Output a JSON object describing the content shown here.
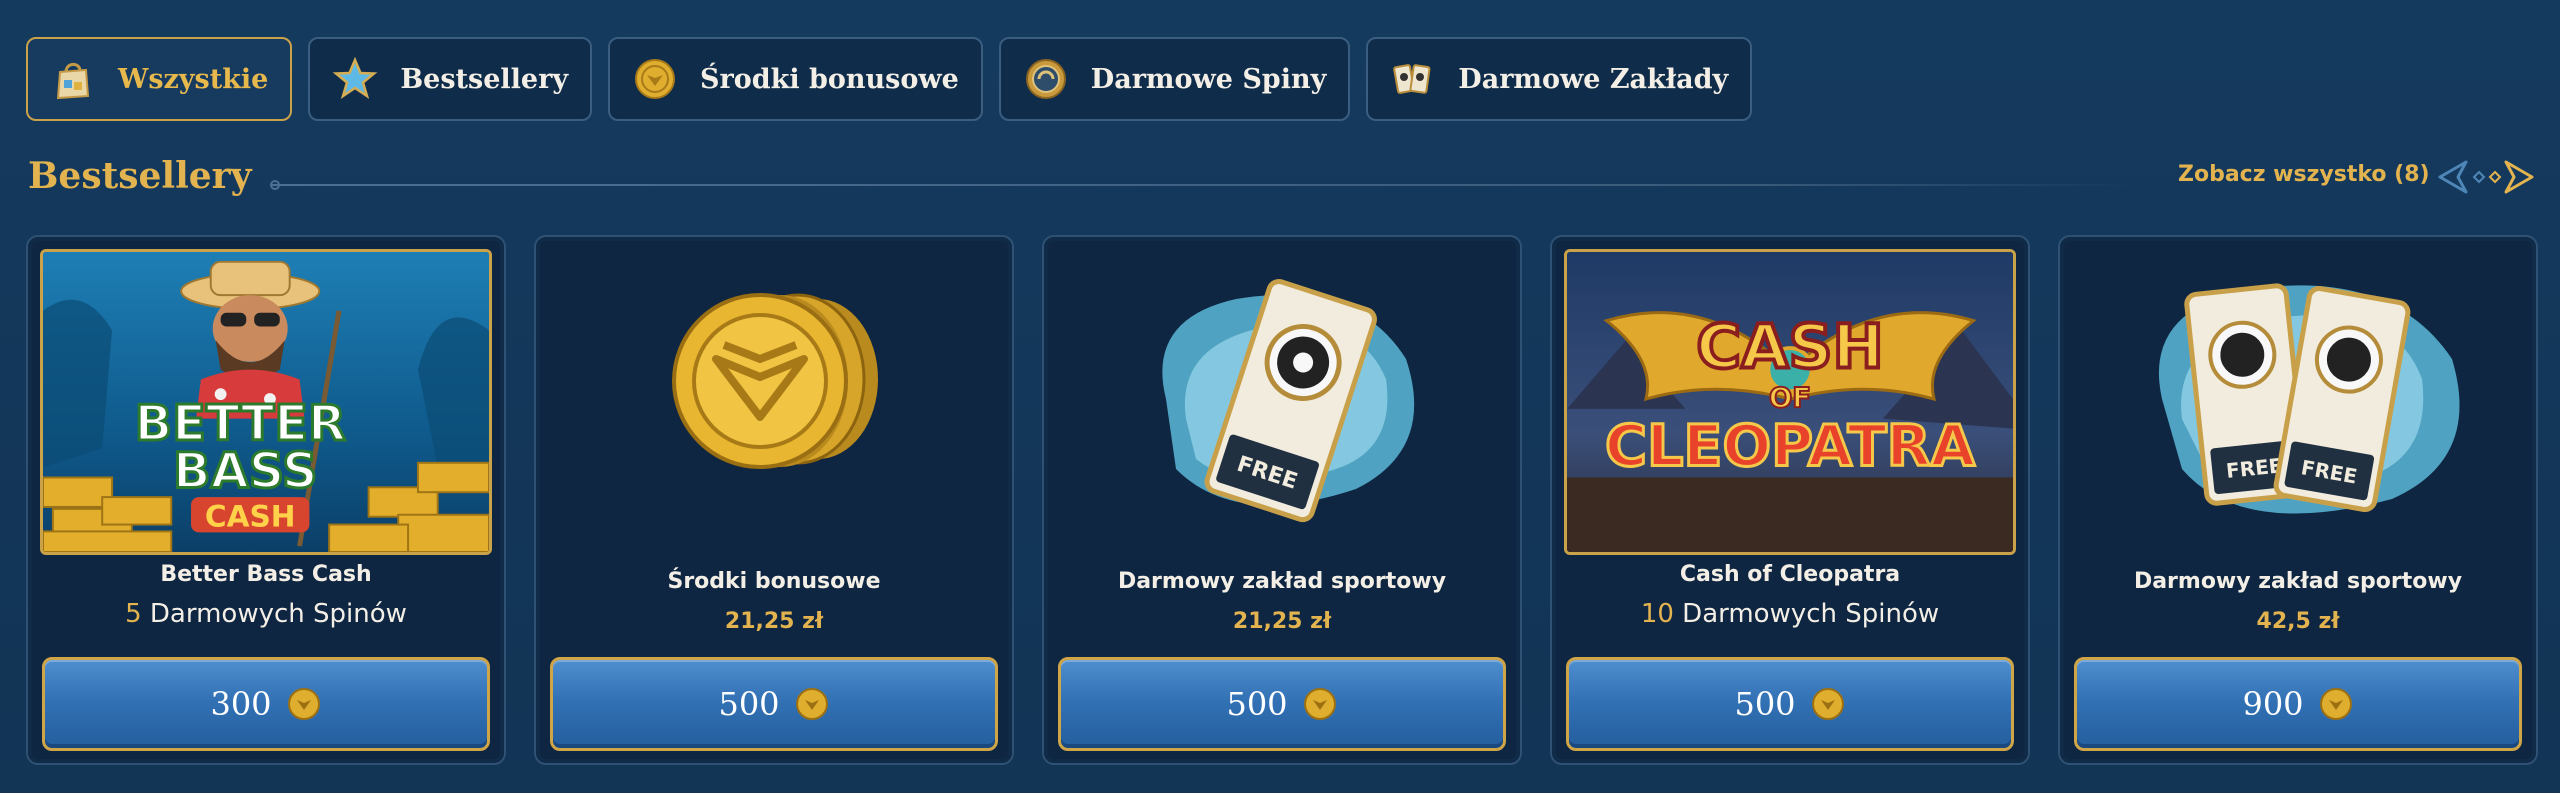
{
  "tabs": [
    {
      "label": "Wszystkie",
      "icon": "shopping-bag-icon",
      "active": true
    },
    {
      "label": "Bestsellery",
      "icon": "star-icon",
      "active": false
    },
    {
      "label": "Środki bonusowe",
      "icon": "coin-icon",
      "active": false
    },
    {
      "label": "Darmowe Spiny",
      "icon": "spin-chip-icon",
      "active": false
    },
    {
      "label": "Darmowe Zakłady",
      "icon": "bet-tickets-icon",
      "active": false
    }
  ],
  "section": {
    "title": "Bestsellery",
    "see_all": "Zobacz wszystko (8)"
  },
  "cards": [
    {
      "title": "Better Bass Cash",
      "sub_num": "5",
      "sub_text": " Darmowych Spinów",
      "price": "",
      "cost": "300",
      "image": "Better Bass Cash"
    },
    {
      "title": "Środki bonusowe",
      "sub_num": "",
      "sub_text": "",
      "price": "21,25 zł",
      "cost": "500",
      "image": "coin-stack"
    },
    {
      "title": "Darmowy zakład sportowy",
      "sub_num": "",
      "sub_text": "",
      "price": "21,25 zł",
      "cost": "500",
      "image": "bet-ticket"
    },
    {
      "title": "Cash of Cleopatra",
      "sub_num": "10",
      "sub_text": " Darmowych Spinów",
      "price": "",
      "cost": "500",
      "image": "Cash of Cleopatra"
    },
    {
      "title": "Darmowy zakład sportowy",
      "sub_num": "",
      "sub_text": "",
      "price": "42,5 zł",
      "cost": "900",
      "image": "bet-tickets"
    }
  ],
  "art": {
    "card1": {
      "line1": "BETTER",
      "line2": "BASS",
      "line3": "CASH"
    },
    "card3": {
      "ticket": "FREE"
    },
    "card4": {
      "line1": "CASH",
      "line2": "OF",
      "line3": "CLEOPATRA"
    },
    "card5": {
      "ticket1": "FREE",
      "ticket2": "FREE"
    }
  },
  "colors": {
    "background": "#123456",
    "accent_gold": "#e2b34f",
    "button_blue": "#3272b5"
  }
}
